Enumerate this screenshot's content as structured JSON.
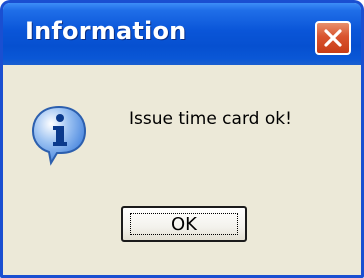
{
  "dialog": {
    "title": "Information",
    "message": "Issue time card ok!",
    "icon": "information-icon",
    "ok_label": "OK",
    "close_icon": "close-icon"
  },
  "colors": {
    "titlebar": "#0a55d8",
    "close_button": "#d9542f",
    "client_background": "#ece9d8",
    "icon_bubble": "#3f7fdc"
  }
}
